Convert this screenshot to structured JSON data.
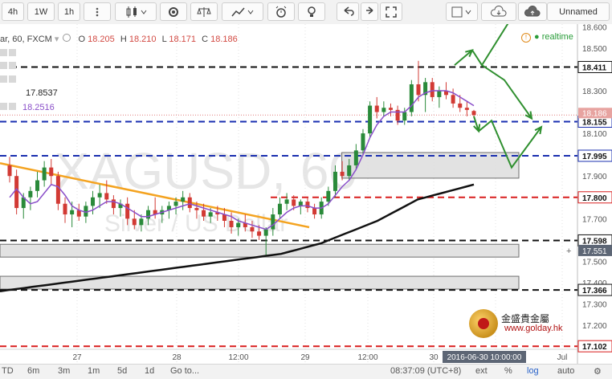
{
  "toolbar": {
    "interval_4h": "4h",
    "interval_1w": "1W",
    "interval_1h": "1h",
    "chart_name_label": "Unnamed"
  },
  "header": {
    "symbol_fragment": "ar, 60, FXCM",
    "o_label": "O",
    "o_value": "18.205",
    "h_label": "H",
    "h_value": "18.210",
    "l_label": "L",
    "l_value": "18.171",
    "c_label": "C",
    "c_value": "18.186",
    "ma1_value": "17.8537",
    "ma2_value": "18.2516",
    "realtime_label": "realtime"
  },
  "watermark": {
    "symbol": "XAGUSD, 60",
    "description": "Silver / US Dollar"
  },
  "logo": {
    "cn_text": "金盛貴金屬",
    "url": "www.golday.hk"
  },
  "bottombar": {
    "tz_fragment": "TD",
    "ranges": [
      "6m",
      "3m",
      "1m",
      "5d",
      "1d"
    ],
    "goto": "Go to...",
    "clock": "08:37:09 (UTC+8)",
    "ext": "ext",
    "pct": "%",
    "log": "log",
    "auto": "auto"
  },
  "colors": {
    "up": "#2a8a3a",
    "down": "#d23a34",
    "ma_purple": "#8a4fc9",
    "ma_black": "#111111",
    "trend_orange": "#f4a320",
    "arrow_green": "#2f8f2f",
    "level_black": "#111111",
    "level_blue": "#1a2fb0",
    "level_red": "#d91e1e",
    "box_fill": "#dedede"
  },
  "chart_data": {
    "type": "candlestick",
    "symbol": "XAGUSD",
    "timeframe": "60",
    "ylim": [
      17.05,
      18.65
    ],
    "y_ticks": [
      "18.600",
      "18.500",
      "18.400",
      "18.300",
      "18.200",
      "18.100",
      "18.000",
      "17.900",
      "17.800",
      "17.700",
      "17.600",
      "17.500",
      "17.400",
      "17.300",
      "17.200",
      "17.100"
    ],
    "x_ticks": [
      "27",
      "28",
      "12:00",
      "29",
      "12:00",
      "30",
      "Jul"
    ],
    "cursor_time_label": "2016-06-30 10:00:00",
    "cursor_price_label": "17.551",
    "last_price_label": "18.186",
    "levels": [
      {
        "price": 18.411,
        "label": "18.411",
        "style": "black"
      },
      {
        "price": 18.155,
        "label": "18.155",
        "style": "blue"
      },
      {
        "price": 17.995,
        "label": "17.995",
        "style": "blue"
      },
      {
        "price": 17.8,
        "label": "17.800",
        "style": "red"
      },
      {
        "price": 17.598,
        "label": "17.598",
        "style": "black"
      },
      {
        "price": 17.366,
        "label": "17.366",
        "style": "black"
      },
      {
        "price": 17.102,
        "label": "17.102",
        "style": "red"
      }
    ],
    "zones": [
      {
        "from": 17.89,
        "to": 18.01,
        "start": 0.56,
        "end": 0.85
      },
      {
        "from": 17.52,
        "to": 17.58,
        "start": 0.0,
        "end": 0.85
      },
      {
        "from": 17.37,
        "to": 17.43,
        "start": 0.0,
        "end": 0.85
      }
    ],
    "candles": [
      {
        "o": 17.95,
        "h": 17.99,
        "l": 17.87,
        "c": 17.9
      },
      {
        "o": 17.9,
        "h": 17.93,
        "l": 17.72,
        "c": 17.75
      },
      {
        "o": 17.75,
        "h": 17.82,
        "l": 17.7,
        "c": 17.8
      },
      {
        "o": 17.8,
        "h": 17.85,
        "l": 17.74,
        "c": 17.83
      },
      {
        "o": 17.83,
        "h": 17.92,
        "l": 17.8,
        "c": 17.88
      },
      {
        "o": 17.88,
        "h": 17.97,
        "l": 17.85,
        "c": 17.94
      },
      {
        "o": 17.94,
        "h": 17.98,
        "l": 17.86,
        "c": 17.9
      },
      {
        "o": 17.9,
        "h": 17.92,
        "l": 17.74,
        "c": 17.77
      },
      {
        "o": 17.77,
        "h": 17.8,
        "l": 17.68,
        "c": 17.72
      },
      {
        "o": 17.72,
        "h": 17.78,
        "l": 17.66,
        "c": 17.74
      },
      {
        "o": 17.74,
        "h": 17.77,
        "l": 17.69,
        "c": 17.71
      },
      {
        "o": 17.71,
        "h": 17.78,
        "l": 17.68,
        "c": 17.76
      },
      {
        "o": 17.76,
        "h": 17.83,
        "l": 17.72,
        "c": 17.8
      },
      {
        "o": 17.8,
        "h": 17.86,
        "l": 17.75,
        "c": 17.82
      },
      {
        "o": 17.82,
        "h": 17.88,
        "l": 17.77,
        "c": 17.79
      },
      {
        "o": 17.79,
        "h": 17.81,
        "l": 17.72,
        "c": 17.75
      },
      {
        "o": 17.75,
        "h": 17.79,
        "l": 17.71,
        "c": 17.77
      },
      {
        "o": 17.77,
        "h": 17.8,
        "l": 17.67,
        "c": 17.7
      },
      {
        "o": 17.7,
        "h": 17.74,
        "l": 17.65,
        "c": 17.67
      },
      {
        "o": 17.67,
        "h": 17.72,
        "l": 17.64,
        "c": 17.7
      },
      {
        "o": 17.7,
        "h": 17.76,
        "l": 17.67,
        "c": 17.74
      },
      {
        "o": 17.74,
        "h": 17.8,
        "l": 17.7,
        "c": 17.72
      },
      {
        "o": 17.72,
        "h": 17.76,
        "l": 17.68,
        "c": 17.74
      },
      {
        "o": 17.74,
        "h": 17.78,
        "l": 17.7,
        "c": 17.76
      },
      {
        "o": 17.76,
        "h": 17.8,
        "l": 17.72,
        "c": 17.78
      },
      {
        "o": 17.78,
        "h": 17.83,
        "l": 17.74,
        "c": 17.8
      },
      {
        "o": 17.8,
        "h": 17.82,
        "l": 17.73,
        "c": 17.75
      },
      {
        "o": 17.75,
        "h": 17.78,
        "l": 17.7,
        "c": 17.74
      },
      {
        "o": 17.74,
        "h": 17.77,
        "l": 17.69,
        "c": 17.71
      },
      {
        "o": 17.71,
        "h": 17.75,
        "l": 17.68,
        "c": 17.73
      },
      {
        "o": 17.73,
        "h": 17.76,
        "l": 17.69,
        "c": 17.72
      },
      {
        "o": 17.72,
        "h": 17.75,
        "l": 17.66,
        "c": 17.69
      },
      {
        "o": 17.69,
        "h": 17.73,
        "l": 17.63,
        "c": 17.66
      },
      {
        "o": 17.66,
        "h": 17.7,
        "l": 17.62,
        "c": 17.68
      },
      {
        "o": 17.68,
        "h": 17.72,
        "l": 17.64,
        "c": 17.66
      },
      {
        "o": 17.66,
        "h": 17.69,
        "l": 17.61,
        "c": 17.64
      },
      {
        "o": 17.64,
        "h": 17.67,
        "l": 17.6,
        "c": 17.62
      },
      {
        "o": 17.62,
        "h": 17.66,
        "l": 17.53,
        "c": 17.65
      },
      {
        "o": 17.65,
        "h": 17.75,
        "l": 17.62,
        "c": 17.72
      },
      {
        "o": 17.72,
        "h": 17.8,
        "l": 17.7,
        "c": 17.77
      },
      {
        "o": 17.77,
        "h": 17.82,
        "l": 17.74,
        "c": 17.79
      },
      {
        "o": 17.79,
        "h": 17.81,
        "l": 17.74,
        "c": 17.76
      },
      {
        "o": 17.76,
        "h": 17.79,
        "l": 17.72,
        "c": 17.78
      },
      {
        "o": 17.78,
        "h": 17.8,
        "l": 17.73,
        "c": 17.75
      },
      {
        "o": 17.75,
        "h": 17.77,
        "l": 17.7,
        "c": 17.72
      },
      {
        "o": 17.72,
        "h": 17.8,
        "l": 17.7,
        "c": 17.78
      },
      {
        "o": 17.78,
        "h": 17.85,
        "l": 17.76,
        "c": 17.83
      },
      {
        "o": 17.83,
        "h": 17.95,
        "l": 17.8,
        "c": 17.92
      },
      {
        "o": 17.92,
        "h": 17.97,
        "l": 17.88,
        "c": 17.9
      },
      {
        "o": 17.9,
        "h": 17.98,
        "l": 17.88,
        "c": 17.95
      },
      {
        "o": 17.95,
        "h": 18.05,
        "l": 17.93,
        "c": 18.02
      },
      {
        "o": 18.02,
        "h": 18.12,
        "l": 18.0,
        "c": 18.1
      },
      {
        "o": 18.1,
        "h": 18.25,
        "l": 18.08,
        "c": 18.23
      },
      {
        "o": 18.23,
        "h": 18.27,
        "l": 18.17,
        "c": 18.2
      },
      {
        "o": 18.2,
        "h": 18.25,
        "l": 18.18,
        "c": 18.22
      },
      {
        "o": 18.22,
        "h": 18.24,
        "l": 18.18,
        "c": 18.21
      },
      {
        "o": 18.21,
        "h": 18.23,
        "l": 18.14,
        "c": 18.16
      },
      {
        "o": 18.16,
        "h": 18.22,
        "l": 18.14,
        "c": 18.2
      },
      {
        "o": 18.2,
        "h": 18.35,
        "l": 18.18,
        "c": 18.33
      },
      {
        "o": 18.33,
        "h": 18.44,
        "l": 18.25,
        "c": 18.28
      },
      {
        "o": 18.28,
        "h": 18.36,
        "l": 18.2,
        "c": 18.34
      },
      {
        "o": 18.34,
        "h": 18.36,
        "l": 18.25,
        "c": 18.27
      },
      {
        "o": 18.27,
        "h": 18.32,
        "l": 18.22,
        "c": 18.3
      },
      {
        "o": 18.3,
        "h": 18.34,
        "l": 18.26,
        "c": 18.28
      },
      {
        "o": 18.28,
        "h": 18.31,
        "l": 18.22,
        "c": 18.24
      },
      {
        "o": 18.24,
        "h": 18.28,
        "l": 18.2,
        "c": 18.22
      },
      {
        "o": 18.22,
        "h": 18.25,
        "l": 18.18,
        "c": 18.21
      },
      {
        "o": 18.205,
        "h": 18.21,
        "l": 18.171,
        "c": 18.186
      }
    ],
    "ma_fast": [
      17.8,
      17.84,
      17.8,
      17.77,
      17.78,
      17.82,
      17.86,
      17.85,
      17.81,
      17.76,
      17.74,
      17.73,
      17.74,
      17.76,
      17.78,
      17.78,
      17.77,
      17.75,
      17.73,
      17.71,
      17.71,
      17.72,
      17.73,
      17.74,
      17.75,
      17.76,
      17.77,
      17.76,
      17.75,
      17.74,
      17.73,
      17.72,
      17.71,
      17.69,
      17.68,
      17.67,
      17.66,
      17.65,
      17.67,
      17.7,
      17.73,
      17.75,
      17.76,
      17.76,
      17.75,
      17.75,
      17.77,
      17.81,
      17.85,
      17.88,
      17.93,
      18.0,
      18.08,
      18.14,
      18.18,
      18.2,
      18.2,
      18.2,
      18.23,
      18.27,
      18.29,
      18.3,
      18.3,
      18.3,
      18.29,
      18.27,
      18.25,
      18.23
    ],
    "ma_slow": [
      17.36,
      17.365,
      17.37,
      17.375,
      17.38,
      17.385,
      17.39,
      17.395,
      17.4,
      17.405,
      17.41,
      17.415,
      17.42,
      17.425,
      17.43,
      17.435,
      17.44,
      17.445,
      17.45,
      17.455,
      17.46,
      17.465,
      17.47,
      17.475,
      17.48,
      17.485,
      17.49,
      17.495,
      17.5,
      17.505,
      17.51,
      17.515,
      17.52,
      17.525,
      17.53,
      17.535,
      17.545,
      17.555,
      17.565,
      17.575,
      17.585,
      17.6,
      17.615,
      17.63,
      17.645,
      17.66,
      17.675,
      17.69,
      17.71,
      17.73,
      17.75,
      17.77,
      17.79,
      17.8,
      17.81,
      17.82,
      17.83,
      17.84,
      17.85,
      17.86
    ]
  }
}
